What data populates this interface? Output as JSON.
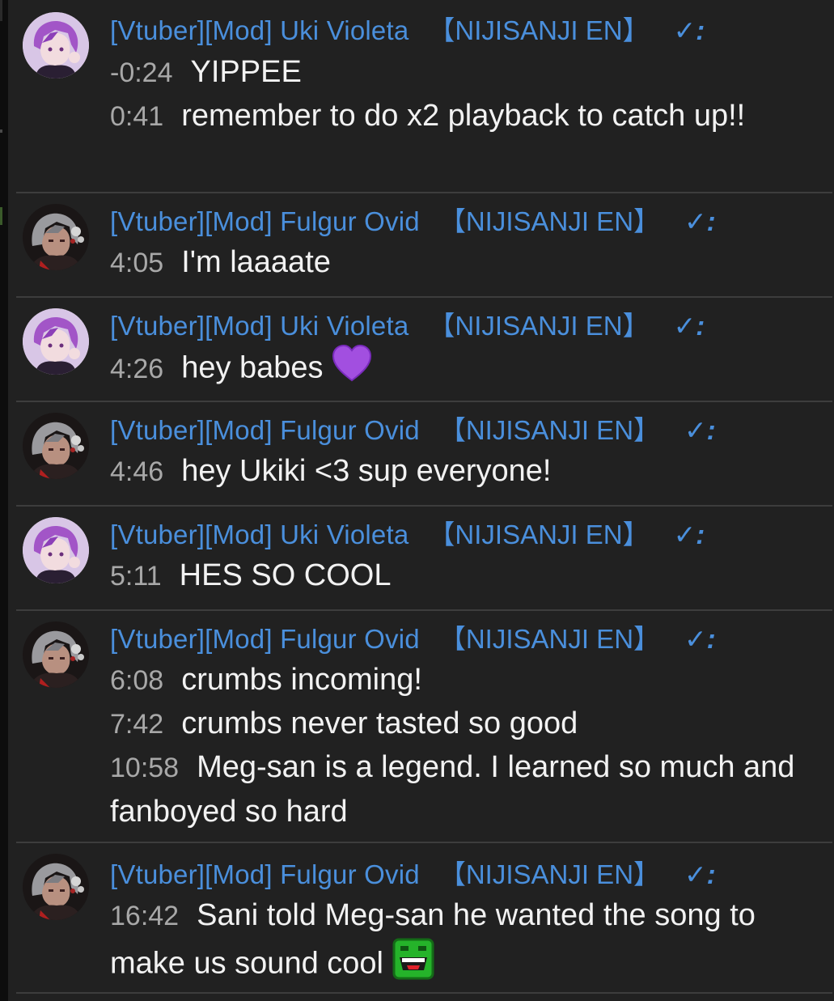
{
  "chat": {
    "groups": [
      {
        "author": {
          "prefix": "[Vtuber][Mod] Uki Violeta",
          "agency": "【NIJISANJI EN】",
          "verified": "✓:"
        },
        "avatar": "uki-violeta-avatar",
        "messages": [
          {
            "time": "-0:24",
            "text": "YIPPEE"
          },
          {
            "time": "0:41",
            "text": "remember to do x2 playback to catch up!!"
          }
        ]
      },
      {
        "author": {
          "prefix": "[Vtuber][Mod] Fulgur Ovid",
          "agency": "【NIJISANJI EN】",
          "verified": "✓:"
        },
        "avatar": "fulgur-ovid-avatar",
        "messages": [
          {
            "time": "4:05",
            "text": "I'm laaaate"
          }
        ]
      },
      {
        "author": {
          "prefix": "[Vtuber][Mod] Uki Violeta",
          "agency": "【NIJISANJI EN】",
          "verified": "✓:"
        },
        "avatar": "uki-violeta-avatar",
        "messages": [
          {
            "time": "4:26",
            "text": "hey babes",
            "emoji": "purple-heart-emoji"
          }
        ]
      },
      {
        "author": {
          "prefix": "[Vtuber][Mod] Fulgur Ovid",
          "agency": "【NIJISANJI EN】",
          "verified": "✓:"
        },
        "avatar": "fulgur-ovid-avatar",
        "messages": [
          {
            "time": "4:46",
            "text": "hey Ukiki <3 sup everyone!"
          }
        ]
      },
      {
        "author": {
          "prefix": "[Vtuber][Mod] Uki Violeta",
          "agency": "【NIJISANJI EN】",
          "verified": "✓:"
        },
        "avatar": "uki-violeta-avatar",
        "messages": [
          {
            "time": "5:11",
            "text": "HES SO COOL"
          }
        ]
      },
      {
        "author": {
          "prefix": "[Vtuber][Mod] Fulgur Ovid",
          "agency": "【NIJISANJI EN】",
          "verified": "✓:"
        },
        "avatar": "fulgur-ovid-avatar",
        "messages": [
          {
            "time": "6:08",
            "text": "crumbs incoming!"
          },
          {
            "time": "7:42",
            "text": "crumbs never tasted so good"
          },
          {
            "time": "10:58",
            "text": "Meg-san is a legend. I learned so much and fanboyed so hard"
          }
        ]
      },
      {
        "author": {
          "prefix": "[Vtuber][Mod] Fulgur Ovid",
          "agency": "【NIJISANJI EN】",
          "verified": "✓:"
        },
        "avatar": "fulgur-ovid-avatar",
        "messages": [
          {
            "time": "16:42",
            "text": "Sani told Meg-san he wanted the song to make us sound cool",
            "emoji": "green-laughing-face-emoji"
          }
        ]
      }
    ]
  },
  "colors": {
    "background": "#212121",
    "author": "#4a8fdc",
    "timestamp": "#a8a8a8",
    "message": "#f2f2f2",
    "divider": "#3d3d3d"
  }
}
